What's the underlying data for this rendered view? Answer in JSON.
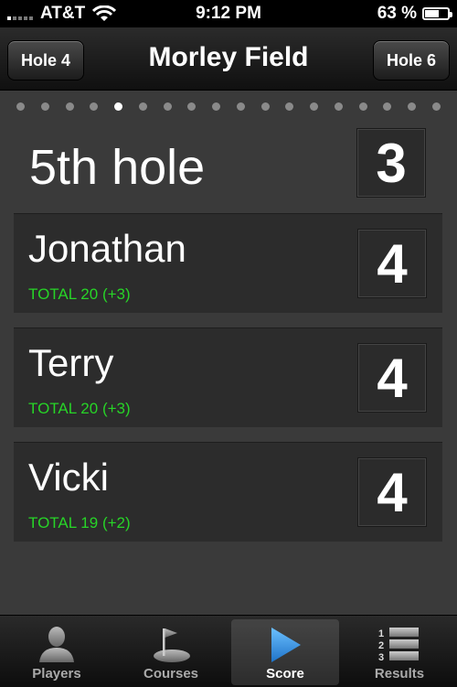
{
  "status_bar": {
    "carrier": "AT&T",
    "time": "9:12 PM",
    "battery": "63 %",
    "battery_level": 0.63
  },
  "nav": {
    "title": "Morley Field",
    "prev_label": "Hole 4",
    "next_label": "Hole 6"
  },
  "page_dots": {
    "count": 18,
    "active_index": 4
  },
  "hole": {
    "title": "5th hole",
    "par": "3"
  },
  "players": [
    {
      "name": "Jonathan",
      "total": "TOTAL 20 (+3)",
      "score": "4"
    },
    {
      "name": "Terry",
      "total": "TOTAL 20 (+3)",
      "score": "4"
    },
    {
      "name": "Vicki",
      "total": "TOTAL 19 (+2)",
      "score": "4"
    }
  ],
  "tabs": [
    {
      "label": "Players",
      "icon": "person-icon"
    },
    {
      "label": "Courses",
      "icon": "golf-flag-icon"
    },
    {
      "label": "Score",
      "icon": "play-icon",
      "selected": true
    },
    {
      "label": "Results",
      "icon": "ranked-list-icon"
    }
  ],
  "colors": {
    "background": "#3a3a3a",
    "row": "#2c2c2c",
    "total_text": "#27d427",
    "score_tab_accent": "#3c9be8"
  }
}
